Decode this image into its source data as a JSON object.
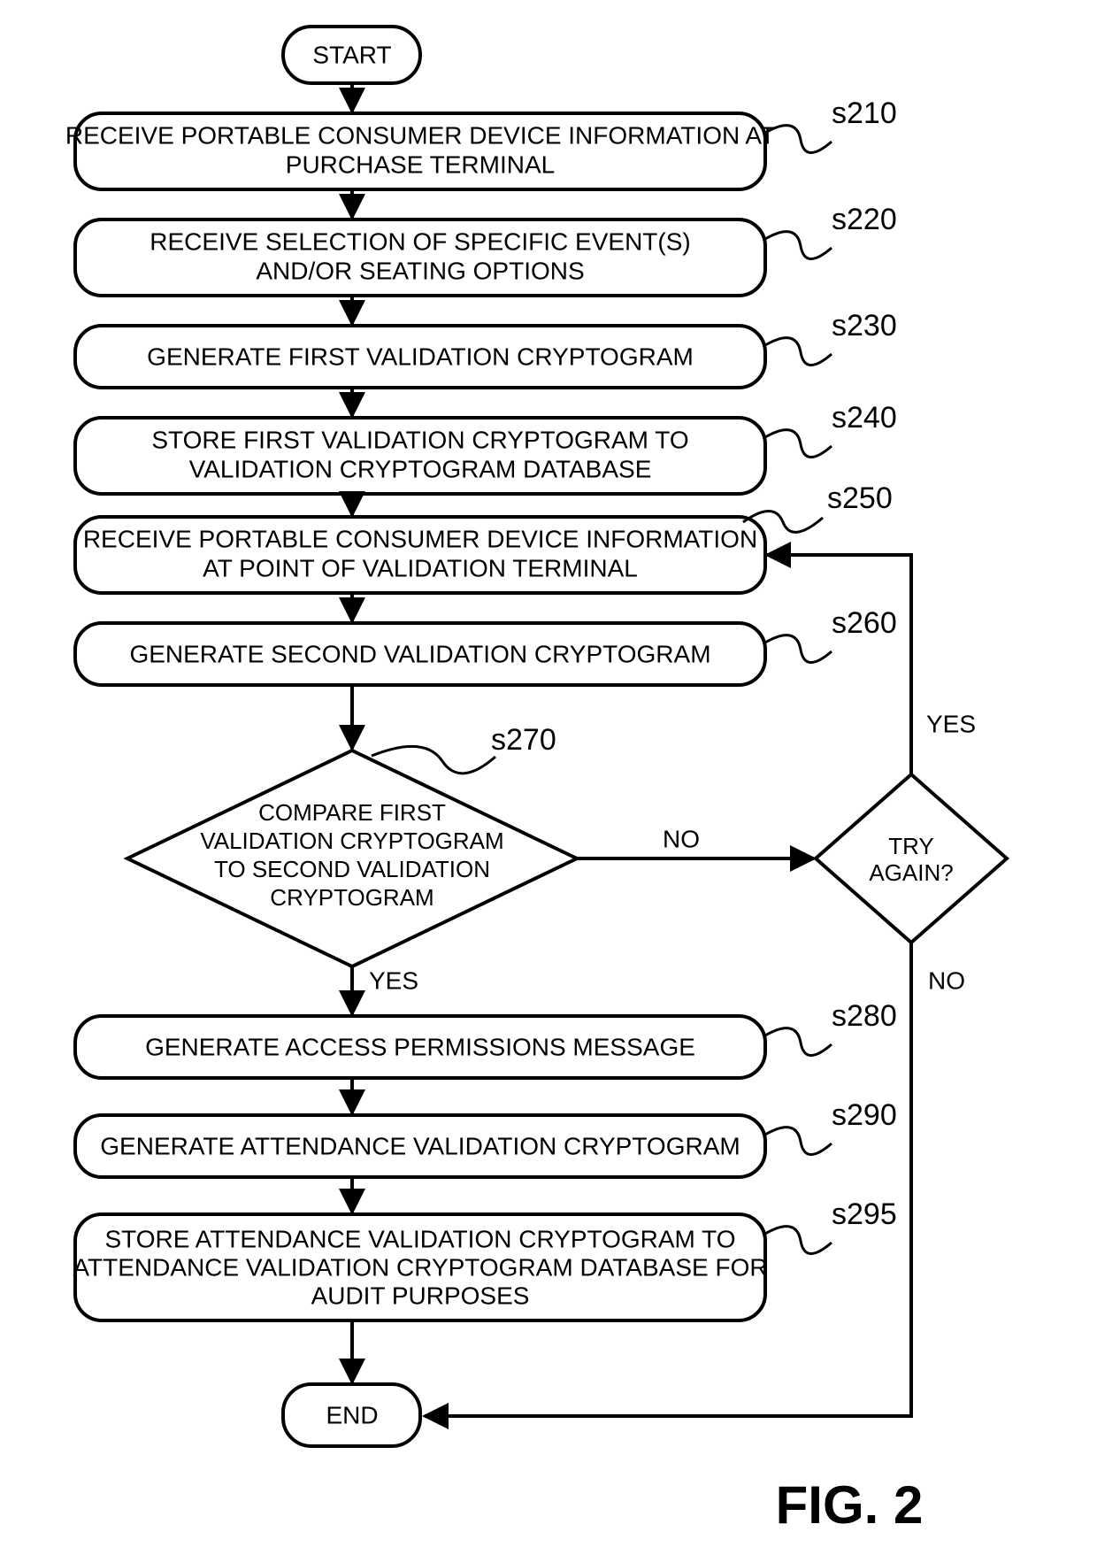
{
  "figure_label": "FIG. 2",
  "start": "START",
  "end": "END",
  "steps": {
    "s210": {
      "ref": "s210",
      "lines": [
        "RECEIVE PORTABLE CONSUMER DEVICE INFORMATION AT",
        "PURCHASE TERMINAL"
      ]
    },
    "s220": {
      "ref": "s220",
      "lines": [
        "RECEIVE SELECTION OF SPECIFIC EVENT(S)",
        "AND/OR SEATING OPTIONS"
      ]
    },
    "s230": {
      "ref": "s230",
      "lines": [
        "GENERATE FIRST VALIDATION CRYPTOGRAM"
      ]
    },
    "s240": {
      "ref": "s240",
      "lines": [
        "STORE  FIRST VALIDATION CRYPTOGRAM TO",
        "VALIDATION CRYPTOGRAM DATABASE"
      ]
    },
    "s250": {
      "ref": "s250",
      "lines": [
        "RECEIVE PORTABLE CONSUMER DEVICE INFORMATION",
        "AT POINT OF VALIDATION TERMINAL"
      ]
    },
    "s260": {
      "ref": "s260",
      "lines": [
        "GENERATE SECOND VALIDATION CRYPTOGRAM"
      ]
    },
    "s270": {
      "ref": "s270",
      "lines": [
        "COMPARE FIRST",
        "VALIDATION CRYPTOGRAM",
        "TO SECOND VALIDATION",
        "CRYPTOGRAM"
      ]
    },
    "s280": {
      "ref": "s280",
      "lines": [
        "GENERATE ACCESS PERMISSIONS MESSAGE"
      ]
    },
    "s290": {
      "ref": "s290",
      "lines": [
        "GENERATE ATTENDANCE VALIDATION CRYPTOGRAM"
      ]
    },
    "s295": {
      "ref": "s295",
      "lines": [
        "STORE ATTENDANCE VALIDATION CRYPTOGRAM TO",
        "ATTENDANCE VALIDATION CRYPTOGRAM DATABASE FOR",
        "AUDIT PURPOSES"
      ]
    }
  },
  "decision2": {
    "lines": [
      "TRY",
      "AGAIN?"
    ]
  },
  "labels": {
    "yes": "YES",
    "no": "NO"
  }
}
